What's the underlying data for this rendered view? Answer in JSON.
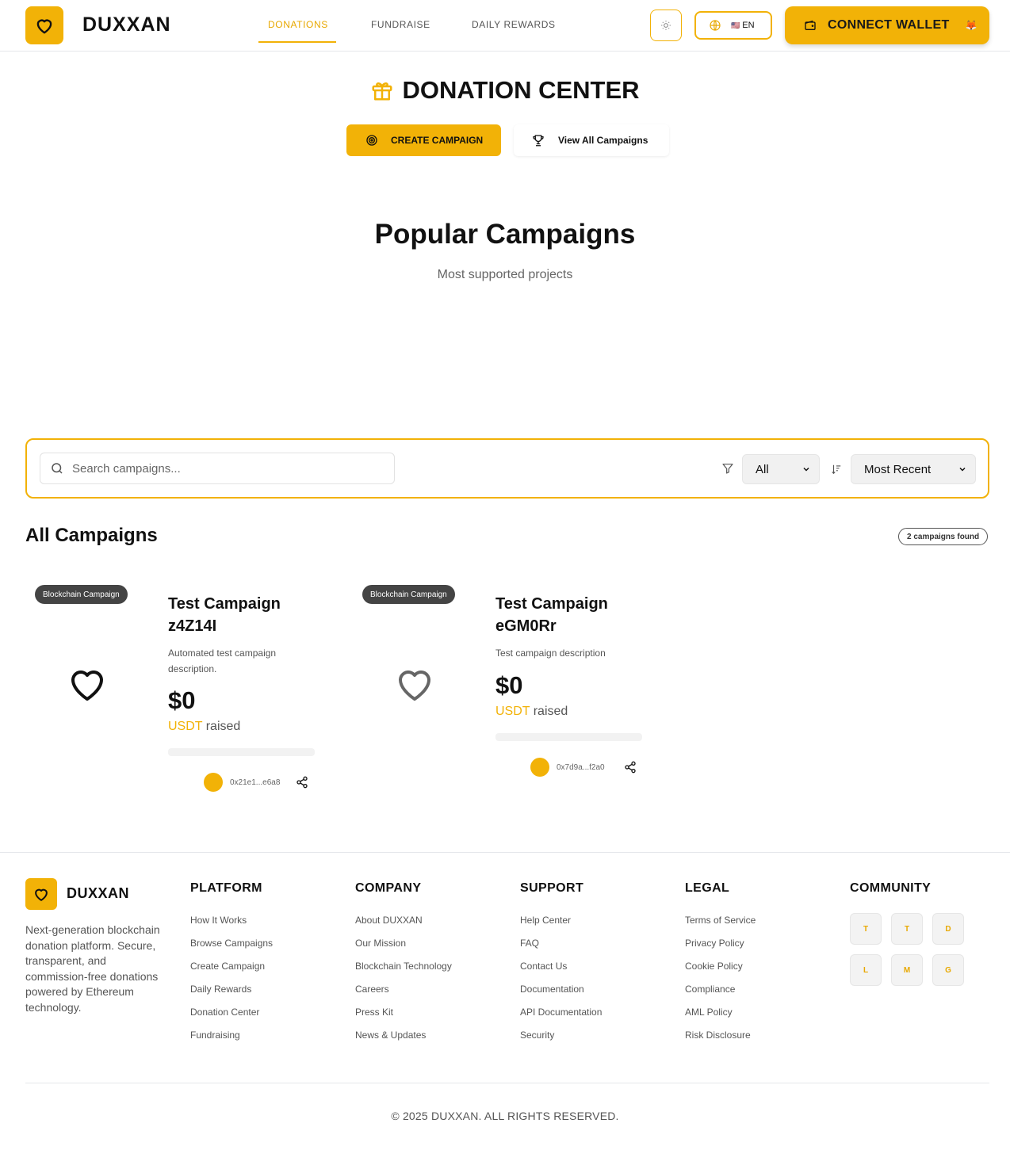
{
  "header": {
    "brand": "DUXXAN",
    "nav": [
      {
        "label": "DONATIONS",
        "active": true
      },
      {
        "label": "FUNDRAISE",
        "active": false
      },
      {
        "label": "DAILY REWARDS",
        "active": false
      }
    ],
    "language": "EN",
    "language_flag": "🇺🇸",
    "connect_wallet": "CONNECT WALLET",
    "wallet_emoji": "🦊"
  },
  "donation_center": {
    "title": "DONATION CENTER",
    "create_button": "CREATE CAMPAIGN",
    "view_button": "View All Campaigns"
  },
  "popular": {
    "title": "Popular Campaigns",
    "subtitle": "Most supported projects"
  },
  "filters": {
    "search_placeholder": "Search campaigns...",
    "category_selected": "All",
    "sort_selected": "Most Recent"
  },
  "campaigns_section": {
    "title": "All Campaigns",
    "count_badge": "2 campaigns found"
  },
  "campaigns": [
    {
      "tag": "Blockchain Campaign",
      "title": "Test Campaign z4Z14I",
      "description": "Automated test campaign description.",
      "amount": "$0",
      "currency": "USDT",
      "raised_label": "raised",
      "progress": 0,
      "owner": "0x21e1...e6a8"
    },
    {
      "tag": "Blockchain Campaign",
      "title": "Test Campaign eGM0Rr",
      "description": "Test campaign description",
      "amount": "$0",
      "currency": "USDT",
      "raised_label": "raised",
      "progress": 0,
      "owner": "0x7d9a...f2a0"
    }
  ],
  "footer": {
    "brand": "DUXXAN",
    "description": "Next-generation blockchain donation platform. Secure, transparent, and commission-free donations powered by Ethereum technology.",
    "columns": [
      {
        "title": "PLATFORM",
        "links": [
          "How It Works",
          "Browse Campaigns",
          "Create Campaign",
          "Daily Rewards",
          "Donation Center",
          "Fundraising"
        ]
      },
      {
        "title": "COMPANY",
        "links": [
          "About DUXXAN",
          "Our Mission",
          "Blockchain Technology",
          "Careers",
          "Press Kit",
          "News & Updates"
        ]
      },
      {
        "title": "SUPPORT",
        "links": [
          "Help Center",
          "FAQ",
          "Contact Us",
          "Documentation",
          "API Documentation",
          "Security"
        ]
      },
      {
        "title": "LEGAL",
        "links": [
          "Terms of Service",
          "Privacy Policy",
          "Cookie Policy",
          "Compliance",
          "AML Policy",
          "Risk Disclosure"
        ]
      }
    ],
    "community_title": "COMMUNITY",
    "community_icons": [
      "T",
      "T",
      "D",
      "L",
      "M",
      "G"
    ],
    "copyright": "© 2025 DUXXAN. ALL RIGHTS RESERVED."
  },
  "colors": {
    "accent": "#f2b207",
    "text": "#111111",
    "muted": "#555555"
  }
}
